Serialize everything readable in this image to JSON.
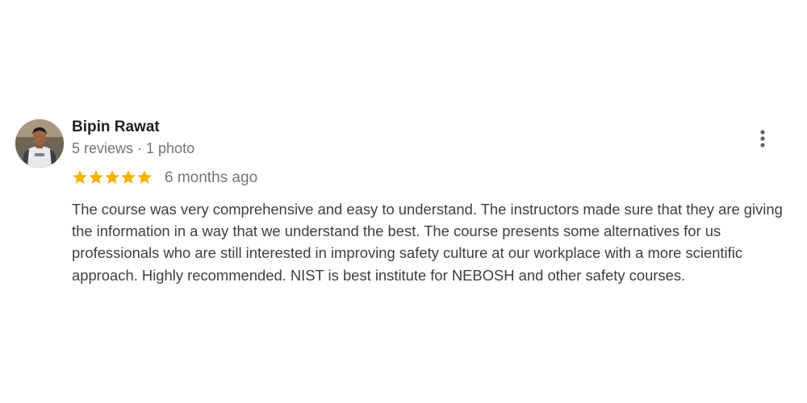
{
  "review": {
    "reviewer_name": "Bipin Rawat",
    "reviewer_meta": "5 reviews · 1 photo",
    "rating": 5,
    "rating_max": 5,
    "time_ago": "6 months ago",
    "text": "The course was very comprehensive and easy to understand. The instructors made sure that they are giving the information in a way that we understand the best. The course presents some alternatives for us professionals who are still interested in improving safety culture at our workplace with a more scientific approach. Highly recommended. NIST is best institute for NEBOSH and other safety courses.",
    "more_menu_icon": "more-vert-icon",
    "star_color": "#f4b400",
    "avatar_icon": "user-photo-avatar"
  }
}
